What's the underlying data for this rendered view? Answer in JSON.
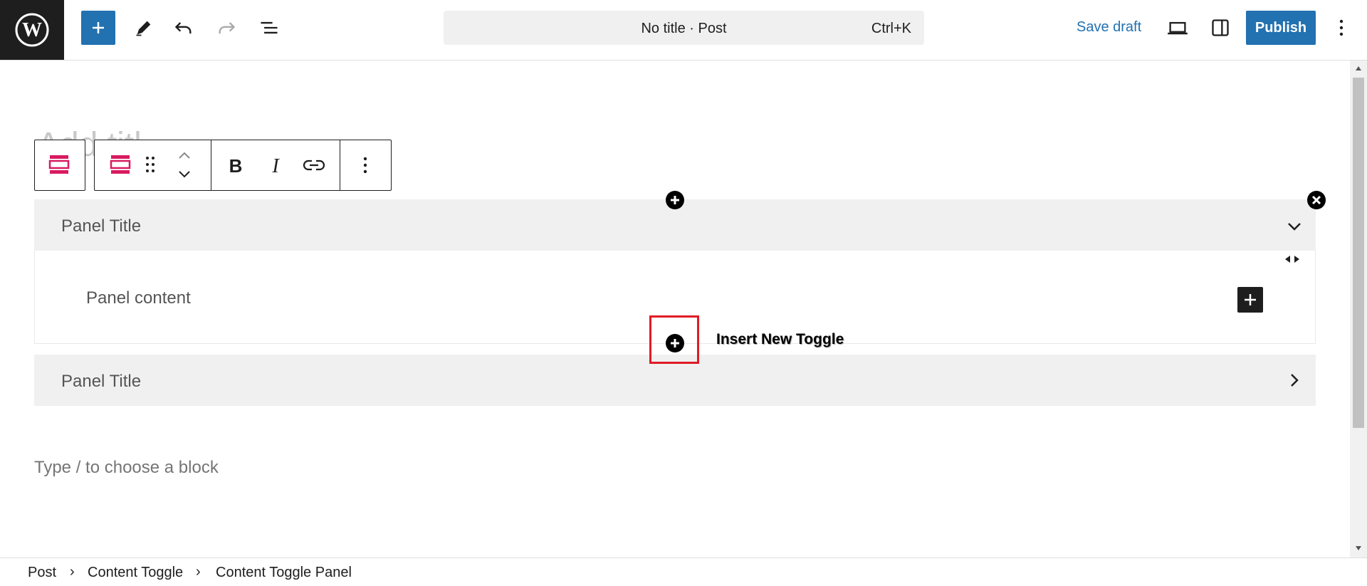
{
  "header": {
    "command_bar_title": "No title · Post",
    "command_bar_shortcut": "Ctrl+K",
    "save_draft_label": "Save draft",
    "publish_label": "Publish",
    "icons": [
      "wordpress-logo-icon",
      "plus-icon",
      "pencil-icon",
      "undo-icon",
      "redo-icon",
      "list-view-icon",
      "desktop-icon",
      "sidebar-icon",
      "more-vertical-icon"
    ]
  },
  "editor": {
    "ghost_title": "Add titl",
    "panels": [
      {
        "title": "Panel Title",
        "content": "Panel content",
        "expanded": true
      },
      {
        "title": "Panel Title",
        "expanded": false
      }
    ],
    "insert_toggle_label": "Insert New Toggle",
    "block_placeholder": "Type / to choose a block",
    "accent_color": "#2271b1",
    "block_icon_color": "#d81b60",
    "highlight_color": "#e01b24"
  },
  "breadcrumb": {
    "items": [
      "Post",
      "Content Toggle",
      "Content Toggle Panel"
    ]
  }
}
